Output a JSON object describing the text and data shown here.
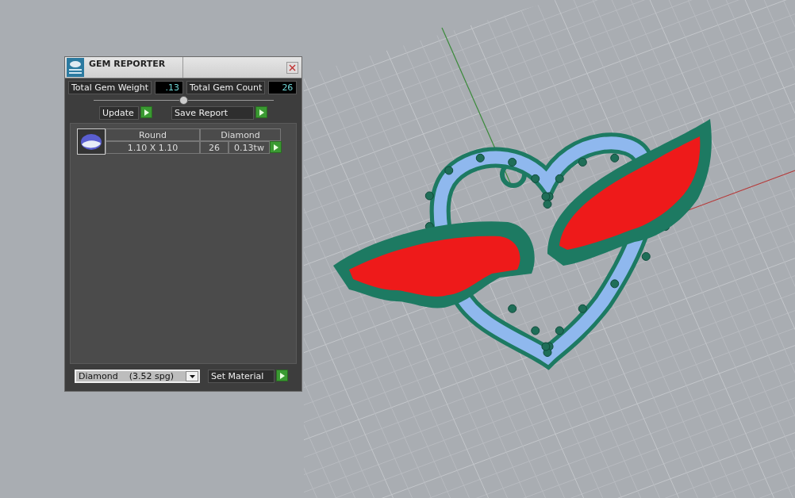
{
  "window": {
    "title": "GEM REPORTER"
  },
  "totals": [
    {
      "label": "Total Gem Weight",
      "value": ".13"
    },
    {
      "label": "Total Gem Count",
      "value": "26"
    }
  ],
  "buttons": [
    {
      "label": "Update"
    },
    {
      "label": "Save Report"
    }
  ],
  "gems": [
    {
      "shape": "Round",
      "material": "Diamond",
      "size": "1.10 X 1.10",
      "count": "26",
      "weight": "0.13tw"
    }
  ],
  "material_select": {
    "value": "Diamond    (3.52 spg)"
  },
  "set_material": {
    "label": "Set Material"
  }
}
